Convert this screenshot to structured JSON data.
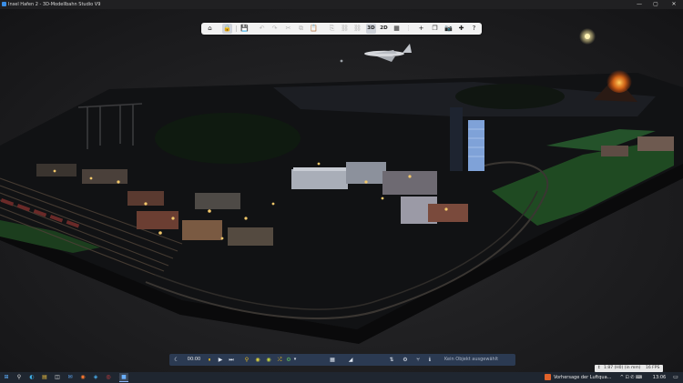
{
  "window": {
    "title": "Insel Hafen 2 - 3D-Modellbahn Studio V9",
    "minimize": "—",
    "maximize": "▢",
    "close": "✕"
  },
  "toolbar": {
    "home": "⌂",
    "lock": "🔒",
    "save": "💾",
    "undo": "↶",
    "redo": "↷",
    "cut": "✂",
    "copy": "⧉",
    "paste": "📋",
    "copy2": "⎘",
    "link": "⛓",
    "unlink": "⛓",
    "view3d": "3D",
    "view2d": "2D",
    "grid": "▦",
    "more": "⋮",
    "add": "+",
    "layers": "❐",
    "camera": "📷",
    "puzzle": "✚",
    "help": "?"
  },
  "bottombar": {
    "night_mode": "☾",
    "time": "00:00",
    "pause": "⏸",
    "play": "▶",
    "skip": "⏭",
    "search": "⚲",
    "zoom_a": "◉",
    "zoom_b": "◉",
    "shuffle": "⤮",
    "tools": "⚙",
    "tools_arrow": "▾",
    "grid_toggle": "▦",
    "terrain": "◢",
    "sliders": "⇅",
    "settings": "⚙",
    "signal": "⑂",
    "info": "ℹ",
    "status": "Kein Objekt ausgewählt"
  },
  "statuspill": {
    "scale_icon": "↕",
    "scale": "1:87 (H0) (in mm)",
    "fps": "16 FPS"
  },
  "taskbar": {
    "start": "⊞",
    "search": "⚲",
    "edge": "◐",
    "explorer": "▤",
    "store": "◫",
    "mail": "✉",
    "firefox": "◉",
    "app1": "◈",
    "app2": "◎",
    "app3": "◆",
    "app_active": "■",
    "news": "Vorhersage der Luftqua...",
    "tray": "^ ⊡ ✆ ⌨",
    "time": "13:06",
    "notify": "▭"
  },
  "colors": {
    "titlebar": "#202022",
    "toolbar": "#f2f2f2",
    "bottombar": "#2b3a52",
    "taskbar": "#1f2630",
    "accent": "#8ab4f8"
  }
}
